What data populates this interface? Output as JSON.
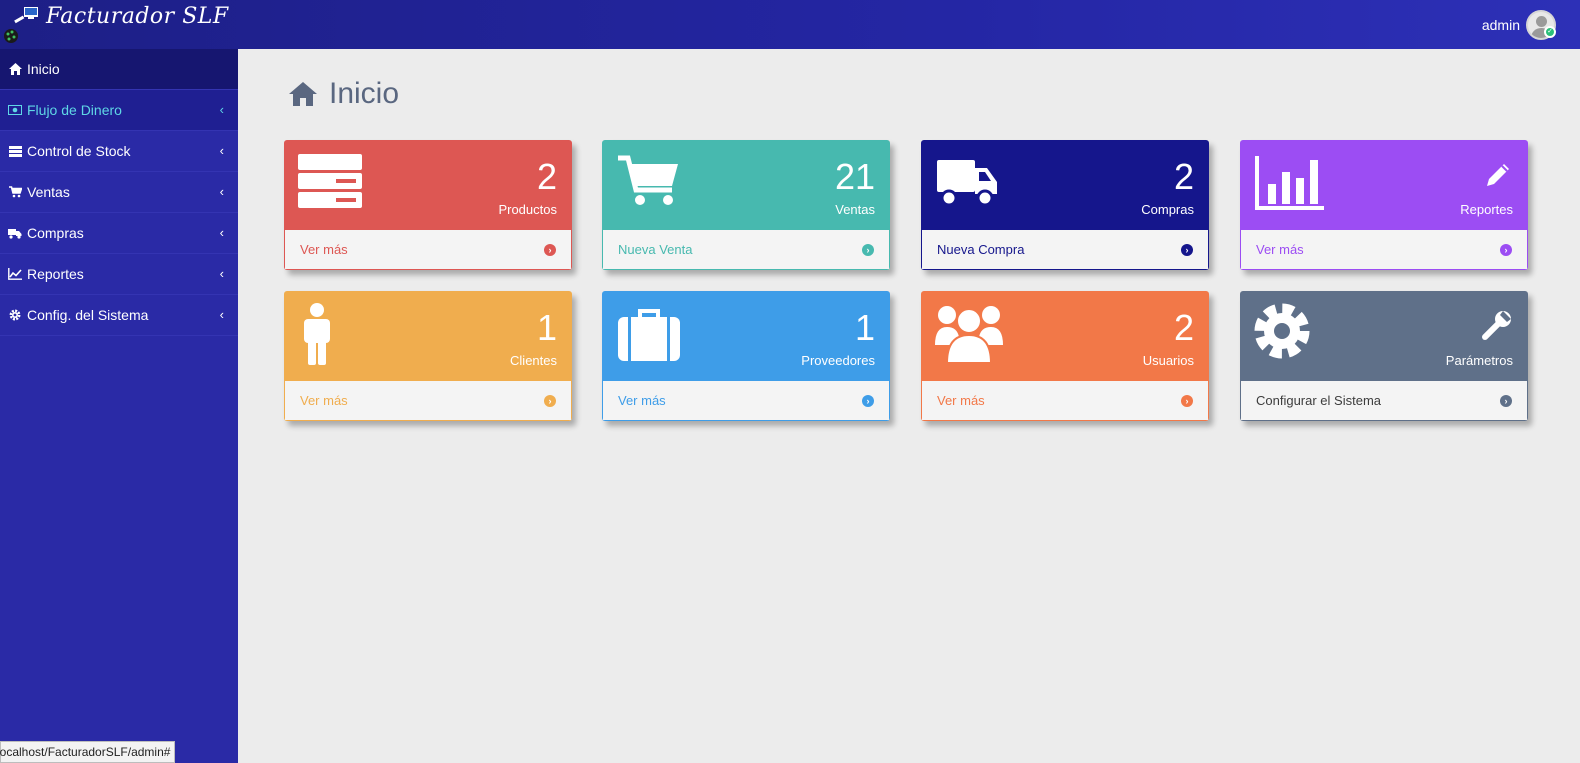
{
  "app": {
    "title": "Facturador SLF"
  },
  "user": {
    "name": "admin"
  },
  "sidebar": {
    "items": [
      {
        "label": "Inicio",
        "icon": "home-icon",
        "state": "active"
      },
      {
        "label": "Flujo de Dinero",
        "icon": "money-icon",
        "state": "open"
      },
      {
        "label": "Control de Stock",
        "icon": "server-icon",
        "state": "normal"
      },
      {
        "label": "Ventas",
        "icon": "cart-icon",
        "state": "normal"
      },
      {
        "label": "Compras",
        "icon": "truck-icon",
        "state": "normal"
      },
      {
        "label": "Reportes",
        "icon": "line-chart-icon",
        "state": "normal"
      },
      {
        "label": "Config. del Sistema",
        "icon": "gear-icon",
        "state": "normal"
      }
    ]
  },
  "page": {
    "title": "Inicio",
    "icon": "home-icon"
  },
  "cards": [
    {
      "count": "2",
      "label": "Productos",
      "link": "Ver más",
      "icon": "server-icon",
      "color": "#dd5753"
    },
    {
      "count": "21",
      "label": "Ventas",
      "link": "Nueva Venta",
      "icon": "cart-icon",
      "color": "#47b9af"
    },
    {
      "count": "2",
      "label": "Compras",
      "link": "Nueva Compra",
      "icon": "truck-icon",
      "color": "#15168c"
    },
    {
      "count": "",
      "label": "Reportes",
      "link": "Ver más",
      "icon": "bar-chart-icon",
      "color": "#9c4df3"
    },
    {
      "count": "1",
      "label": "Clientes",
      "link": "Ver más",
      "icon": "male-icon",
      "color": "#f0ad4e"
    },
    {
      "count": "1",
      "label": "Proveedores",
      "link": "Ver más",
      "icon": "suitcase-icon",
      "color": "#3e9de8"
    },
    {
      "count": "2",
      "label": "Usuarios",
      "link": "Ver más",
      "icon": "users-icon",
      "color": "#f27848"
    },
    {
      "count": "",
      "label": "Parámetros",
      "link": "Configurar el Sistema",
      "icon": "gear-icon",
      "color": "#5f7089"
    }
  ],
  "statusbar": {
    "url": "localhost/FacturadorSLF/admin#"
  }
}
